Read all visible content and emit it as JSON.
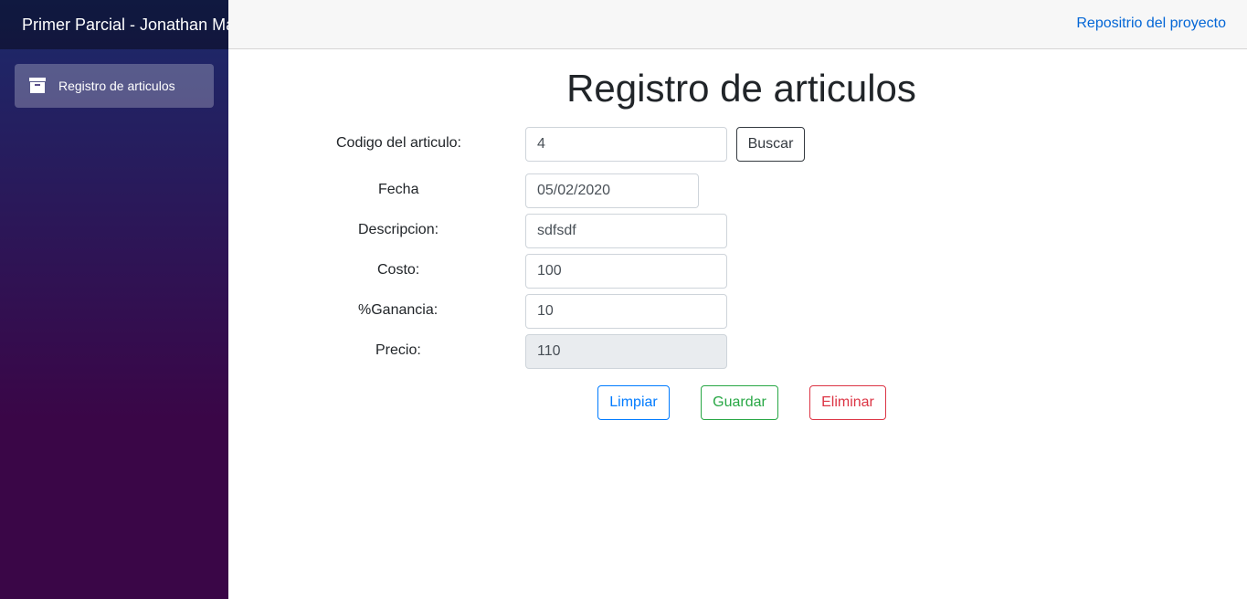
{
  "sidebar": {
    "brand": "Primer Parcial - Jonathan Ma",
    "items": [
      {
        "icon": "box-icon",
        "label": "Registro de articulos"
      }
    ]
  },
  "header": {
    "link_label": "Repositrio del proyecto"
  },
  "form": {
    "title": "Registro de articulos",
    "codigo": {
      "label": "Codigo del articulo:",
      "value": "4"
    },
    "buscar_label": "Buscar",
    "fecha": {
      "label": "Fecha",
      "value": "05/02/2020"
    },
    "descripcion": {
      "label": "Descripcion:",
      "value": "sdfsdf"
    },
    "costo": {
      "label": "Costo:",
      "value": "100"
    },
    "ganancia": {
      "label": "%Ganancia:",
      "value": "10"
    },
    "precio": {
      "label": "Precio:",
      "value": "110"
    },
    "buttons": {
      "limpiar": "Limpiar",
      "guardar": "Guardar",
      "eliminar": "Eliminar"
    }
  },
  "colors": {
    "link": "#0366d6",
    "primary": "#007bff",
    "success": "#28a745",
    "danger": "#dc3545"
  }
}
